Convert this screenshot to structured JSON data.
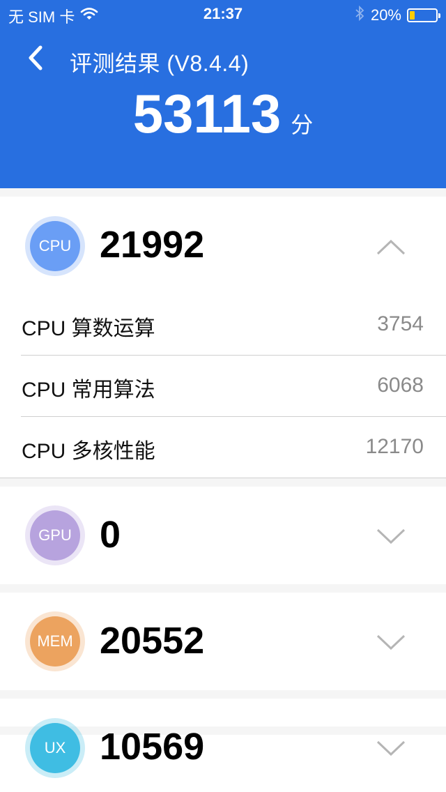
{
  "status_bar": {
    "carrier": "无 SIM 卡",
    "time": "21:37",
    "battery_percent_label": "20%",
    "battery_level": 0.2,
    "icons": [
      "wifi-icon",
      "bluetooth-icon",
      "battery-icon"
    ]
  },
  "nav": {
    "title": "评测结果 (V8.4.4)",
    "back_icon": "chevron-left-icon"
  },
  "total": {
    "score": "53113",
    "unit": "分"
  },
  "colors": {
    "header_bg": "#286fe0",
    "cpu": "#6a9ef5",
    "gpu": "#b7a3de",
    "mem": "#eca35f",
    "ux": "#3fbde3",
    "battery": "#ffcc00"
  },
  "sections": [
    {
      "badge": "CPU",
      "score": "21992",
      "expanded": true,
      "items": [
        {
          "label": "CPU 算数运算",
          "value": "3754"
        },
        {
          "label": "CPU 常用算法",
          "value": "6068"
        },
        {
          "label": "CPU 多核性能",
          "value": "12170"
        }
      ]
    },
    {
      "badge": "GPU",
      "score": "0",
      "expanded": false
    },
    {
      "badge": "MEM",
      "score": "20552",
      "expanded": false
    },
    {
      "badge": "UX",
      "score": "10569",
      "expanded": false
    }
  ]
}
